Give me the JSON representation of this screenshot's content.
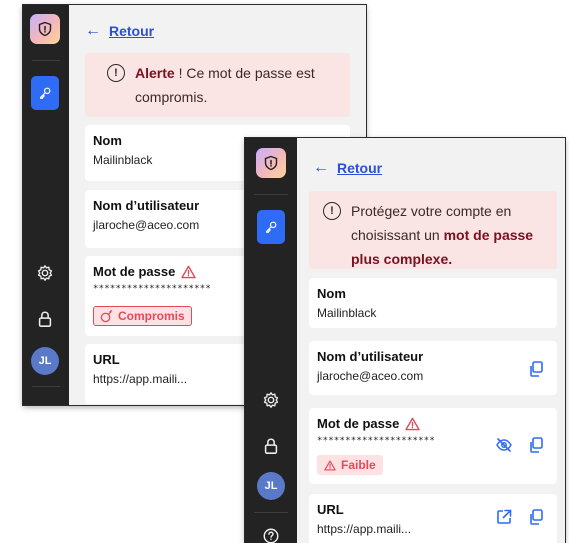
{
  "colors": {
    "sidebar_bg": "#232323",
    "accent_blue": "#2f6cf6",
    "alert_bg": "#fbe4e4",
    "danger": "#e24a5c",
    "link": "#2b4fd6"
  },
  "back_window": {
    "back_link": {
      "arrow": "←",
      "label": "Retour"
    },
    "alert": {
      "strong": "Alerte",
      "text": " ! Ce mot de passe est compromis."
    },
    "fields": {
      "name": {
        "title": "Nom",
        "value": "Mailinblack"
      },
      "username": {
        "title": "Nom d’utilisateur",
        "value": "jlaroche@aceo.com"
      },
      "password": {
        "title": "Mot de passe",
        "value": "*********************",
        "badge": "Compromis"
      },
      "url": {
        "title": "URL",
        "value": "https://app.maili..."
      }
    },
    "avatar": "JL"
  },
  "front_window": {
    "back_link": {
      "arrow": "←",
      "label": "Retour"
    },
    "alert": {
      "text_before": "Protégez votre compte en choisissant un ",
      "strong": "mot de passe plus complexe."
    },
    "fields": {
      "name": {
        "title": "Nom",
        "value": "Mailinblack"
      },
      "username": {
        "title": "Nom d’utilisateur",
        "value": "jlaroche@aceo.com"
      },
      "password": {
        "title": "Mot de passe",
        "value": "*********************",
        "badge": "Faible"
      },
      "url": {
        "title": "URL",
        "value": "https://app.maili..."
      }
    },
    "avatar": "JL"
  },
  "icons": [
    "shield-logo-icon",
    "key-icon",
    "gear-icon",
    "lock-icon",
    "help-icon",
    "copy-icon",
    "eye-off-icon",
    "external-link-icon",
    "warning-icon",
    "info-icon"
  ]
}
